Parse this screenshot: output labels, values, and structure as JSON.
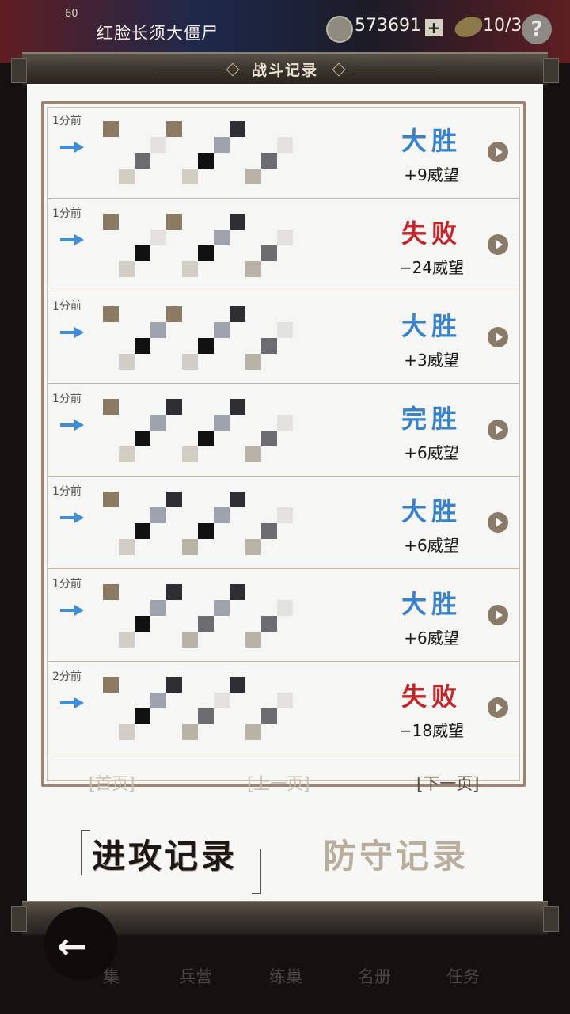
{
  "hud": {
    "level": "60",
    "player_name": "红脸长须大僵尸",
    "coins": "573691",
    "coins_plus": "+",
    "energy": "10/3",
    "help": "?"
  },
  "bottom_nav": [
    "集",
    "兵营",
    "练巢",
    "名册",
    "任务"
  ],
  "dialog": {
    "title": "战斗记录",
    "records": [
      {
        "time": "1分前",
        "result": "大胜",
        "type": "win",
        "points": "+9威望"
      },
      {
        "time": "1分前",
        "result": "失败",
        "type": "lose",
        "points": "−24威望"
      },
      {
        "time": "1分前",
        "result": "大胜",
        "type": "win",
        "points": "+3威望"
      },
      {
        "time": "1分前",
        "result": "完胜",
        "type": "win",
        "points": "+6威望"
      },
      {
        "time": "1分前",
        "result": "大胜",
        "type": "win",
        "points": "+6威望"
      },
      {
        "time": "1分前",
        "result": "大胜",
        "type": "win",
        "points": "+6威望"
      },
      {
        "time": "2分前",
        "result": "失败",
        "type": "lose",
        "points": "−18威望"
      }
    ],
    "pager": {
      "first": "[首页]",
      "prev": "[上一页]",
      "next": "[下一页]"
    },
    "tabs": {
      "attack": "进攻记录",
      "defend": "防守记录"
    }
  },
  "colors": {
    "win": "#3a82c8",
    "lose": "#c3262a",
    "frame": "#9e8470"
  }
}
